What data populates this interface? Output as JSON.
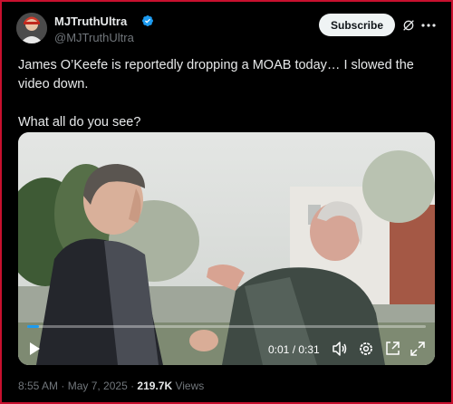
{
  "author": {
    "display_name": "MJTruthUltra",
    "handle": "@MJTruthUltra",
    "verified_color": "#1d9bf0"
  },
  "header": {
    "subscribe_label": "Subscribe",
    "grok_icon": "grok-icon",
    "more_icon": "more-horizontal-icon"
  },
  "tweet": {
    "text_line1": "James O’Keefe is reportedly dropping a MOAB today… I slowed the video down.",
    "text_line2": "What all do you see?"
  },
  "video": {
    "current_time": "0:01",
    "duration": "0:31",
    "time_separator": " / ",
    "progress": 0.03,
    "icons": [
      "play-icon",
      "volume-icon",
      "settings-icon",
      "picture-in-picture-icon",
      "fullscreen-icon"
    ]
  },
  "meta": {
    "time": "8:55 AM",
    "separator": " · ",
    "date": "May 7, 2025",
    "views_count": "219.7K",
    "views_label": " Views"
  },
  "colors": {
    "background": "#000000",
    "text": "#e7e9ea",
    "muted": "#71767b",
    "accent": "#1d9bf0",
    "frame_border": "#c8102e"
  }
}
